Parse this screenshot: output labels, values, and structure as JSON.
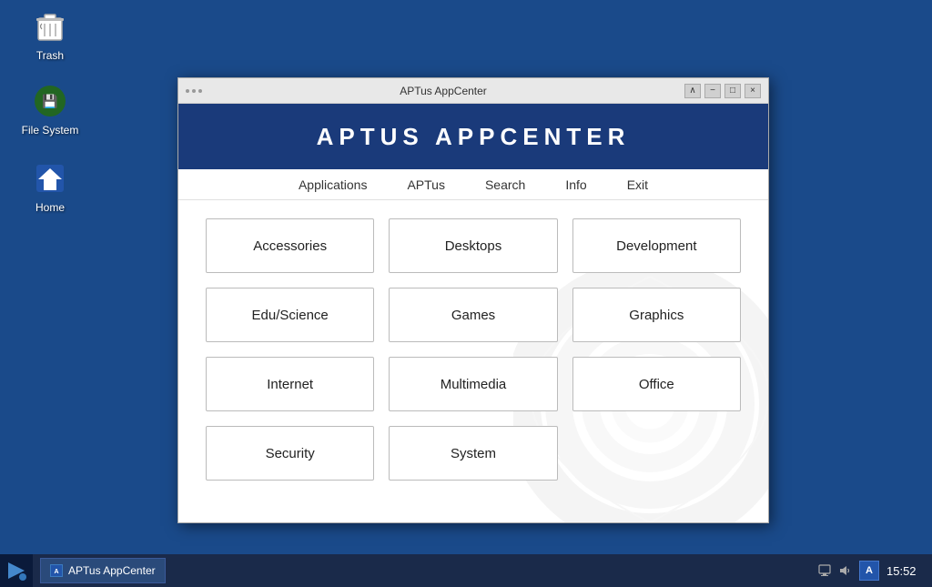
{
  "desktop": {
    "icons": [
      {
        "id": "trash",
        "label": "Trash",
        "color": "#cccccc"
      },
      {
        "id": "filesystem",
        "label": "File System",
        "color": "#44aa44"
      },
      {
        "id": "home",
        "label": "Home",
        "color": "#4488dd"
      }
    ]
  },
  "taskbar": {
    "clock": "15:52",
    "lang": "A",
    "task_label": "APTus AppCenter"
  },
  "window": {
    "title": "APTus AppCenter",
    "header_title": "APTUS  APPCENTER",
    "menu_items": [
      {
        "id": "applications",
        "label": "Applications"
      },
      {
        "id": "aptus",
        "label": "APTus"
      },
      {
        "id": "search",
        "label": "Search"
      },
      {
        "id": "info",
        "label": "Info"
      },
      {
        "id": "exit",
        "label": "Exit"
      }
    ],
    "categories": [
      {
        "id": "accessories",
        "label": "Accessories"
      },
      {
        "id": "desktops",
        "label": "Desktops"
      },
      {
        "id": "development",
        "label": "Development"
      },
      {
        "id": "edu-science",
        "label": "Edu/Science"
      },
      {
        "id": "games",
        "label": "Games"
      },
      {
        "id": "graphics",
        "label": "Graphics"
      },
      {
        "id": "internet",
        "label": "Internet"
      },
      {
        "id": "multimedia",
        "label": "Multimedia"
      },
      {
        "id": "office",
        "label": "Office"
      },
      {
        "id": "security",
        "label": "Security"
      },
      {
        "id": "system",
        "label": "System"
      }
    ],
    "controls": {
      "minimize": "−",
      "maximize": "□",
      "close": "×"
    }
  }
}
